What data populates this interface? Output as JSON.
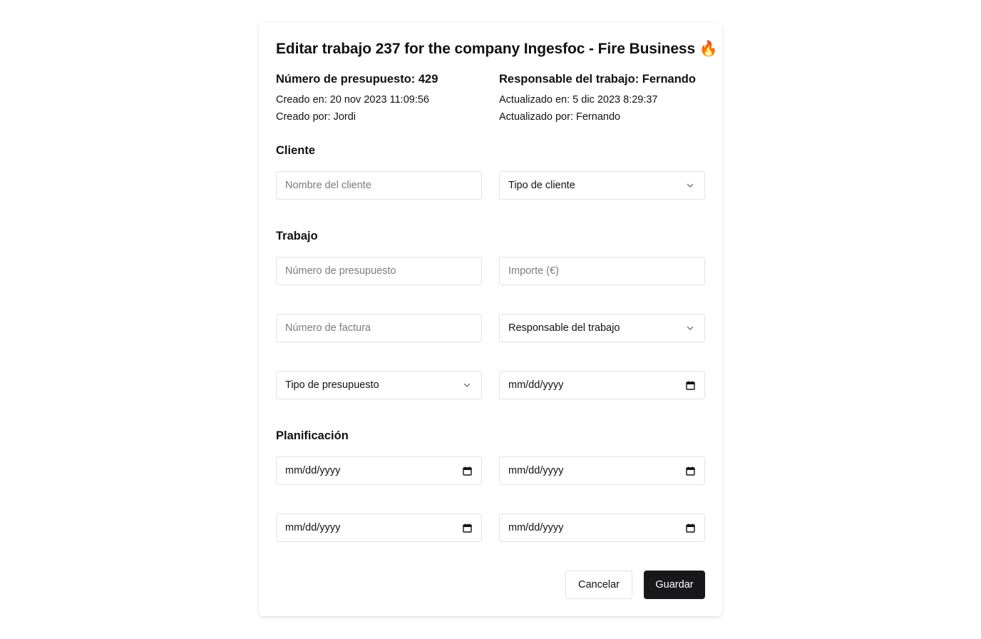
{
  "header": {
    "title": "Editar trabajo 237 for the company Ingesfoc - Fire Business 🔥"
  },
  "meta": {
    "budget_number": "Número de presupuesto: 429",
    "created_at": "Creado en: 20 nov 2023 11:09:56",
    "created_by": "Creado por: Jordi",
    "job_owner": "Responsable del trabajo: Fernando",
    "updated_at": "Actualizado en: 5 dic 2023 8:29:37",
    "updated_by": "Actualizado por: Fernando"
  },
  "sections": {
    "client": "Cliente",
    "job": "Trabajo",
    "planning": "Planificación"
  },
  "client": {
    "name_placeholder": "Nombre del cliente",
    "type_select": "Tipo de cliente"
  },
  "job": {
    "budget_number_placeholder": "Número de presupuesto",
    "amount_placeholder": "Importe (€)",
    "invoice_number_placeholder": "Número de factura",
    "owner_select": "Responsable del trabajo",
    "budget_type_select": "Tipo de presupuesto",
    "date_value": "mm/dd/yyyy"
  },
  "planning": {
    "date_1": "mm/dd/yyyy",
    "date_2": "mm/dd/yyyy",
    "date_3": "mm/dd/yyyy",
    "date_4": "mm/dd/yyyy"
  },
  "actions": {
    "cancel_label": "Cancelar",
    "save_label": "Guardar"
  },
  "icons": {
    "select": "chevron-down-icon",
    "date": "calendar-icon"
  },
  "colors": {
    "primary_button": "#18181b",
    "border": "#e2e2e6",
    "placeholder": "#7b7b82"
  }
}
